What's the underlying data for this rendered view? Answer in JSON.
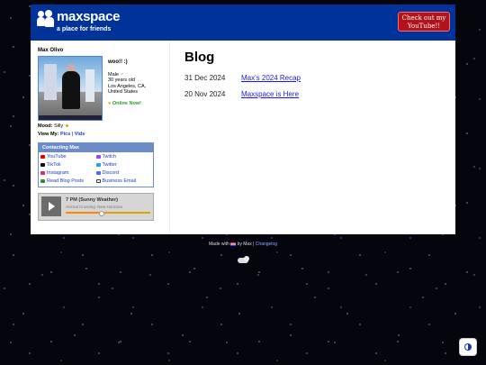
{
  "header": {
    "logo_name": "maxspace",
    "logo_tagline": "a place for friends",
    "youtube_button": "Check out my YouTube!!"
  },
  "profile": {
    "name": "Max Olivo",
    "status": "woo!! :)",
    "gender": "Male",
    "age": "30 years old",
    "location": "Los Angeles, CA,",
    "country": "United States",
    "online": "Online Now!",
    "mood_label": "Mood:",
    "mood_value": "Silly",
    "view_my_label": "View My:",
    "view_pics": "Pics",
    "view_sep": "|",
    "view_vids": "Vids"
  },
  "contact": {
    "title": "Contacting Max",
    "links": [
      "YouTube",
      "Twitch",
      "TikTok",
      "Twitter",
      "Instagram",
      "Discord",
      "Read Blog Posts",
      "Business Email"
    ]
  },
  "player": {
    "song": "7 PM (Sunny Weather)",
    "artist": "Animal Crossing: New Horizons",
    "progress": 0.42
  },
  "blog": {
    "title": "Blog",
    "posts": [
      {
        "date": "31 Dec 2024",
        "title": "Max's 2024 Recap"
      },
      {
        "date": "20 Nov 2024",
        "title": "Maxspace is Here"
      }
    ]
  },
  "footer": {
    "made_with": "Made with",
    "by": "by Max",
    "sep": "|",
    "changelog": "Changelog"
  },
  "colors": {
    "brand": "#003399",
    "youtube_red": "#b3111b",
    "link": "#1a1aee"
  }
}
